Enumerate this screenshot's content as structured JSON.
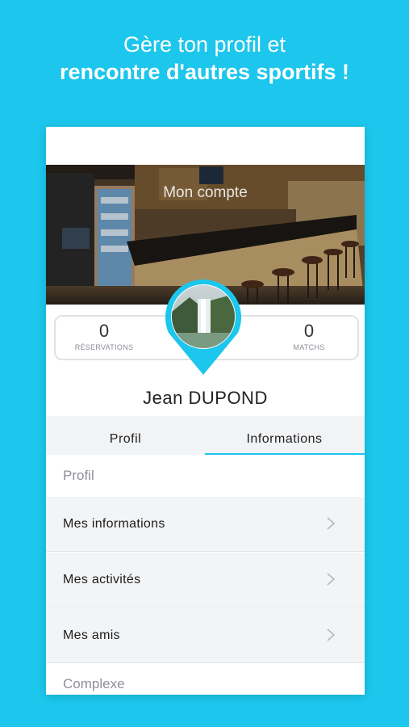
{
  "headline": {
    "line1": "Gère ton profil et",
    "line2": "rencontre d'autres sportifs !"
  },
  "profile": {
    "cover_title": "Mon compte",
    "reservations": {
      "value": "0",
      "label": "RÉSERVATIONS"
    },
    "matchs": {
      "value": "0",
      "label": "MATCHS"
    },
    "name": "Jean  DUPOND"
  },
  "tabs": [
    {
      "label": "Profil",
      "active": false
    },
    {
      "label": "Informations",
      "active": true
    }
  ],
  "sections": {
    "profil_header": "Profil",
    "items": [
      {
        "label": "Mes informations",
        "icon": "chevron-right-icon"
      },
      {
        "label": "Mes activités",
        "icon": "chevron-right-icon"
      },
      {
        "label": "Mes amis",
        "icon": "chevron-right-icon"
      }
    ],
    "complexe_header": "Complexe"
  },
  "colors": {
    "accent": "#1cc6ec",
    "row_bg": "#f3f4f6"
  }
}
